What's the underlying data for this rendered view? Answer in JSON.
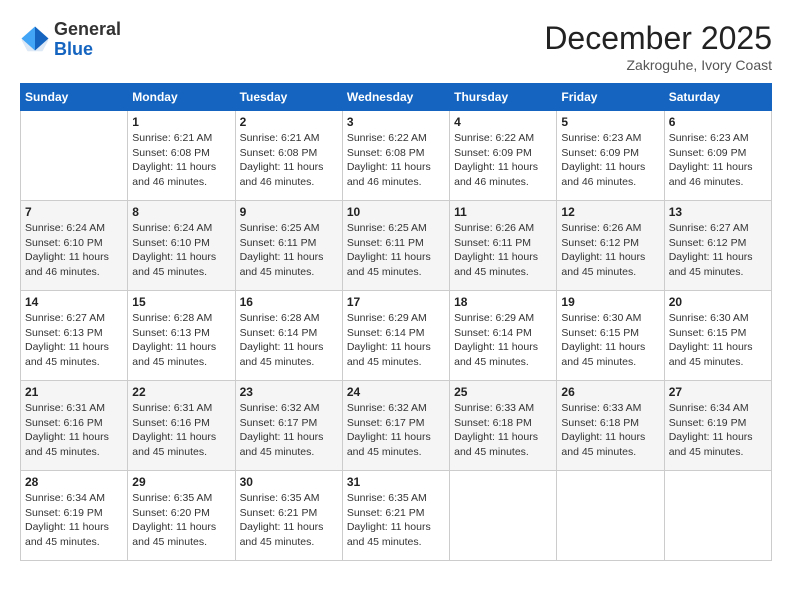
{
  "header": {
    "logo_general": "General",
    "logo_blue": "Blue",
    "month_title": "December 2025",
    "subtitle": "Zakroguhe, Ivory Coast"
  },
  "days_of_week": [
    "Sunday",
    "Monday",
    "Tuesday",
    "Wednesday",
    "Thursday",
    "Friday",
    "Saturday"
  ],
  "weeks": [
    [
      {
        "day": "",
        "sunrise": "",
        "sunset": "",
        "daylight": ""
      },
      {
        "day": "1",
        "sunrise": "Sunrise: 6:21 AM",
        "sunset": "Sunset: 6:08 PM",
        "daylight": "Daylight: 11 hours and 46 minutes."
      },
      {
        "day": "2",
        "sunrise": "Sunrise: 6:21 AM",
        "sunset": "Sunset: 6:08 PM",
        "daylight": "Daylight: 11 hours and 46 minutes."
      },
      {
        "day": "3",
        "sunrise": "Sunrise: 6:22 AM",
        "sunset": "Sunset: 6:08 PM",
        "daylight": "Daylight: 11 hours and 46 minutes."
      },
      {
        "day": "4",
        "sunrise": "Sunrise: 6:22 AM",
        "sunset": "Sunset: 6:09 PM",
        "daylight": "Daylight: 11 hours and 46 minutes."
      },
      {
        "day": "5",
        "sunrise": "Sunrise: 6:23 AM",
        "sunset": "Sunset: 6:09 PM",
        "daylight": "Daylight: 11 hours and 46 minutes."
      },
      {
        "day": "6",
        "sunrise": "Sunrise: 6:23 AM",
        "sunset": "Sunset: 6:09 PM",
        "daylight": "Daylight: 11 hours and 46 minutes."
      }
    ],
    [
      {
        "day": "7",
        "sunrise": "Sunrise: 6:24 AM",
        "sunset": "Sunset: 6:10 PM",
        "daylight": "Daylight: 11 hours and 46 minutes."
      },
      {
        "day": "8",
        "sunrise": "Sunrise: 6:24 AM",
        "sunset": "Sunset: 6:10 PM",
        "daylight": "Daylight: 11 hours and 45 minutes."
      },
      {
        "day": "9",
        "sunrise": "Sunrise: 6:25 AM",
        "sunset": "Sunset: 6:11 PM",
        "daylight": "Daylight: 11 hours and 45 minutes."
      },
      {
        "day": "10",
        "sunrise": "Sunrise: 6:25 AM",
        "sunset": "Sunset: 6:11 PM",
        "daylight": "Daylight: 11 hours and 45 minutes."
      },
      {
        "day": "11",
        "sunrise": "Sunrise: 6:26 AM",
        "sunset": "Sunset: 6:11 PM",
        "daylight": "Daylight: 11 hours and 45 minutes."
      },
      {
        "day": "12",
        "sunrise": "Sunrise: 6:26 AM",
        "sunset": "Sunset: 6:12 PM",
        "daylight": "Daylight: 11 hours and 45 minutes."
      },
      {
        "day": "13",
        "sunrise": "Sunrise: 6:27 AM",
        "sunset": "Sunset: 6:12 PM",
        "daylight": "Daylight: 11 hours and 45 minutes."
      }
    ],
    [
      {
        "day": "14",
        "sunrise": "Sunrise: 6:27 AM",
        "sunset": "Sunset: 6:13 PM",
        "daylight": "Daylight: 11 hours and 45 minutes."
      },
      {
        "day": "15",
        "sunrise": "Sunrise: 6:28 AM",
        "sunset": "Sunset: 6:13 PM",
        "daylight": "Daylight: 11 hours and 45 minutes."
      },
      {
        "day": "16",
        "sunrise": "Sunrise: 6:28 AM",
        "sunset": "Sunset: 6:14 PM",
        "daylight": "Daylight: 11 hours and 45 minutes."
      },
      {
        "day": "17",
        "sunrise": "Sunrise: 6:29 AM",
        "sunset": "Sunset: 6:14 PM",
        "daylight": "Daylight: 11 hours and 45 minutes."
      },
      {
        "day": "18",
        "sunrise": "Sunrise: 6:29 AM",
        "sunset": "Sunset: 6:14 PM",
        "daylight": "Daylight: 11 hours and 45 minutes."
      },
      {
        "day": "19",
        "sunrise": "Sunrise: 6:30 AM",
        "sunset": "Sunset: 6:15 PM",
        "daylight": "Daylight: 11 hours and 45 minutes."
      },
      {
        "day": "20",
        "sunrise": "Sunrise: 6:30 AM",
        "sunset": "Sunset: 6:15 PM",
        "daylight": "Daylight: 11 hours and 45 minutes."
      }
    ],
    [
      {
        "day": "21",
        "sunrise": "Sunrise: 6:31 AM",
        "sunset": "Sunset: 6:16 PM",
        "daylight": "Daylight: 11 hours and 45 minutes."
      },
      {
        "day": "22",
        "sunrise": "Sunrise: 6:31 AM",
        "sunset": "Sunset: 6:16 PM",
        "daylight": "Daylight: 11 hours and 45 minutes."
      },
      {
        "day": "23",
        "sunrise": "Sunrise: 6:32 AM",
        "sunset": "Sunset: 6:17 PM",
        "daylight": "Daylight: 11 hours and 45 minutes."
      },
      {
        "day": "24",
        "sunrise": "Sunrise: 6:32 AM",
        "sunset": "Sunset: 6:17 PM",
        "daylight": "Daylight: 11 hours and 45 minutes."
      },
      {
        "day": "25",
        "sunrise": "Sunrise: 6:33 AM",
        "sunset": "Sunset: 6:18 PM",
        "daylight": "Daylight: 11 hours and 45 minutes."
      },
      {
        "day": "26",
        "sunrise": "Sunrise: 6:33 AM",
        "sunset": "Sunset: 6:18 PM",
        "daylight": "Daylight: 11 hours and 45 minutes."
      },
      {
        "day": "27",
        "sunrise": "Sunrise: 6:34 AM",
        "sunset": "Sunset: 6:19 PM",
        "daylight": "Daylight: 11 hours and 45 minutes."
      }
    ],
    [
      {
        "day": "28",
        "sunrise": "Sunrise: 6:34 AM",
        "sunset": "Sunset: 6:19 PM",
        "daylight": "Daylight: 11 hours and 45 minutes."
      },
      {
        "day": "29",
        "sunrise": "Sunrise: 6:35 AM",
        "sunset": "Sunset: 6:20 PM",
        "daylight": "Daylight: 11 hours and 45 minutes."
      },
      {
        "day": "30",
        "sunrise": "Sunrise: 6:35 AM",
        "sunset": "Sunset: 6:21 PM",
        "daylight": "Daylight: 11 hours and 45 minutes."
      },
      {
        "day": "31",
        "sunrise": "Sunrise: 6:35 AM",
        "sunset": "Sunset: 6:21 PM",
        "daylight": "Daylight: 11 hours and 45 minutes."
      },
      {
        "day": "",
        "sunrise": "",
        "sunset": "",
        "daylight": ""
      },
      {
        "day": "",
        "sunrise": "",
        "sunset": "",
        "daylight": ""
      },
      {
        "day": "",
        "sunrise": "",
        "sunset": "",
        "daylight": ""
      }
    ]
  ]
}
